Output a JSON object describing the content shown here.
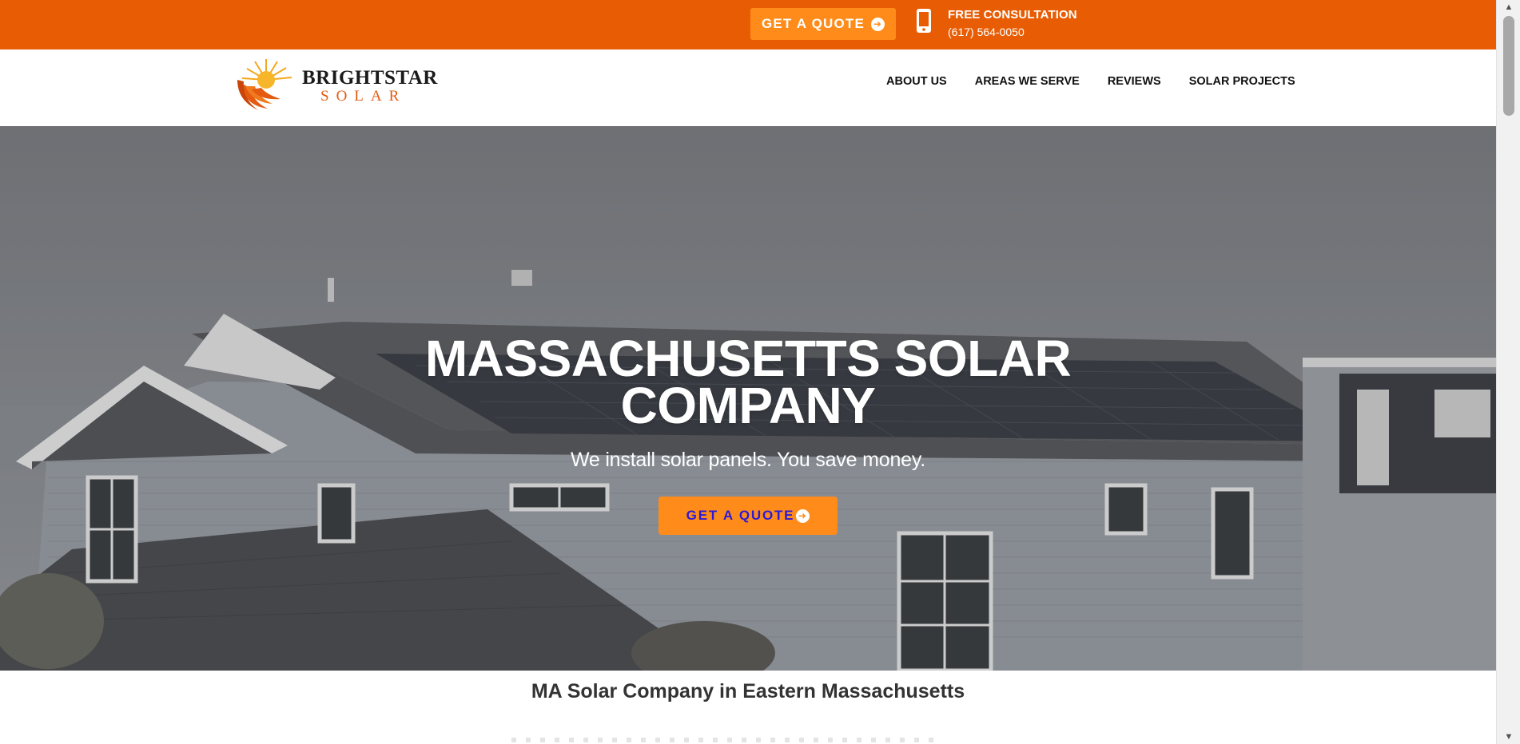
{
  "topbar": {
    "quote_label": "GET A QUOTE",
    "consult_title": "FREE CONSULTATION",
    "consult_phone": "(617) 564-0050",
    "background": "#e85d04",
    "button_color": "#ff8c1a"
  },
  "header": {
    "logo_line1": "BRIGHTSTAR",
    "logo_line2": "SOLAR",
    "nav": [
      {
        "label": "ABOUT US"
      },
      {
        "label": "AREAS WE SERVE"
      },
      {
        "label": "REVIEWS"
      },
      {
        "label": "SOLAR PROJECTS"
      }
    ]
  },
  "hero": {
    "title_line1": "MASSACHUSETTS SOLAR",
    "title_line2": "COMPANY",
    "subtitle": "We install solar panels. You save money.",
    "cta_label": "GET A QUOTE",
    "cta_text_color": "#2a1ad8"
  },
  "section": {
    "heading": "MA Solar Company in Eastern Massachusetts"
  },
  "icons": {
    "top_quote_arrow": "arrow-circle-right-icon",
    "phone": "mobile-phone-icon",
    "logo": "sun-swirl-logo",
    "hero_arrow": "arrow-circle-right-icon"
  }
}
